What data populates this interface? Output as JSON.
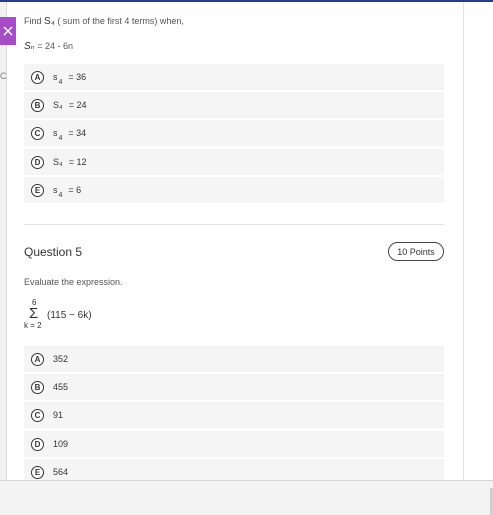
{
  "question4": {
    "prompt_prefix": "Find",
    "prompt_symbol": "S₄",
    "prompt_suffix": "( sum of the first 4 terms) when,",
    "formula_var": "Sₙ",
    "formula_rest": "= 24 - 6n",
    "options": [
      {
        "letter": "A",
        "symbol": "s",
        "sub": "4",
        "text": "= 36"
      },
      {
        "letter": "B",
        "symbol": "S₄",
        "sub": "",
        "text": "= 24"
      },
      {
        "letter": "C",
        "symbol": "s",
        "sub": "4",
        "text": "= 34"
      },
      {
        "letter": "D",
        "symbol": "S₄",
        "sub": "",
        "text": "= 12"
      },
      {
        "letter": "E",
        "symbol": "s",
        "sub": "4",
        "text": "= 6"
      }
    ]
  },
  "question5": {
    "title": "Question 5",
    "points": "10 Points",
    "prompt": "Evaluate the expression.",
    "sum_upper": "6",
    "sum_symbol": "Σ",
    "sum_lower": "k = 2",
    "sum_expression": "(115 − 6k)",
    "options": [
      {
        "letter": "A",
        "text": "352"
      },
      {
        "letter": "B",
        "text": "455"
      },
      {
        "letter": "C",
        "text": "91"
      },
      {
        "letter": "D",
        "text": "109"
      },
      {
        "letter": "E",
        "text": "564"
      }
    ]
  },
  "left_peek_text": "Co",
  "colors": {
    "top_border": "#2a3a8f",
    "close_tab": "#a64dc6",
    "option_background": "#f5f5f5"
  },
  "icons": {
    "close": "close-icon"
  }
}
